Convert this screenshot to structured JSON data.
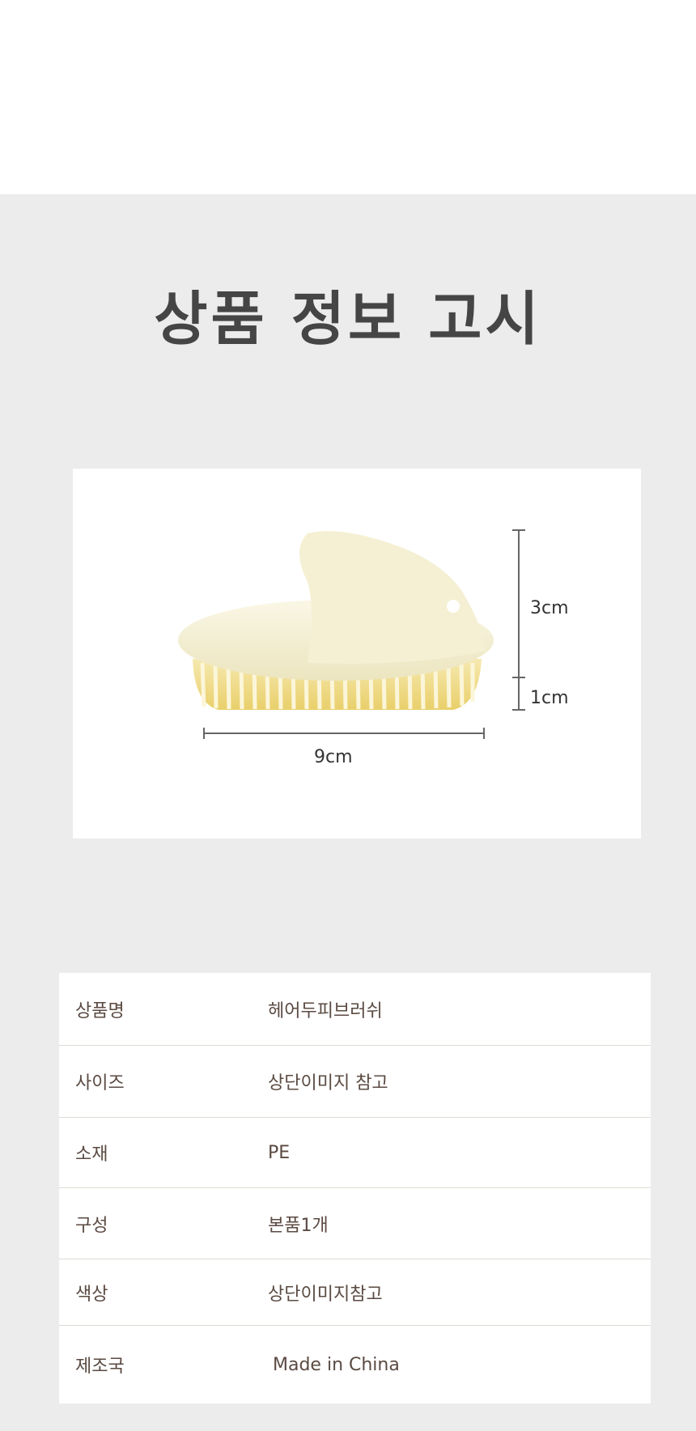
{
  "header": {
    "title": "상품 정보 고시"
  },
  "product_image": {
    "alt": "헤어두피브러쉬",
    "dimensions": {
      "height_top": "3cm",
      "height_bottom": "1cm",
      "width": "9cm"
    }
  },
  "spec_table": {
    "rows": [
      {
        "label": "상품명",
        "value": "헤어두피브러쉬"
      },
      {
        "label": "사이즈",
        "value": "상단이미지 참고"
      },
      {
        "label": "소재",
        "value": "PE"
      },
      {
        "label": "구성",
        "value": "본품1개"
      },
      {
        "label": "색상",
        "value": "상단이미지참고"
      },
      {
        "label": "제조국",
        "value": "Made in China"
      }
    ]
  },
  "colors": {
    "band": "#ececec",
    "title": "#454545",
    "text": "#5a4a42",
    "brush": "#f4efd2"
  }
}
